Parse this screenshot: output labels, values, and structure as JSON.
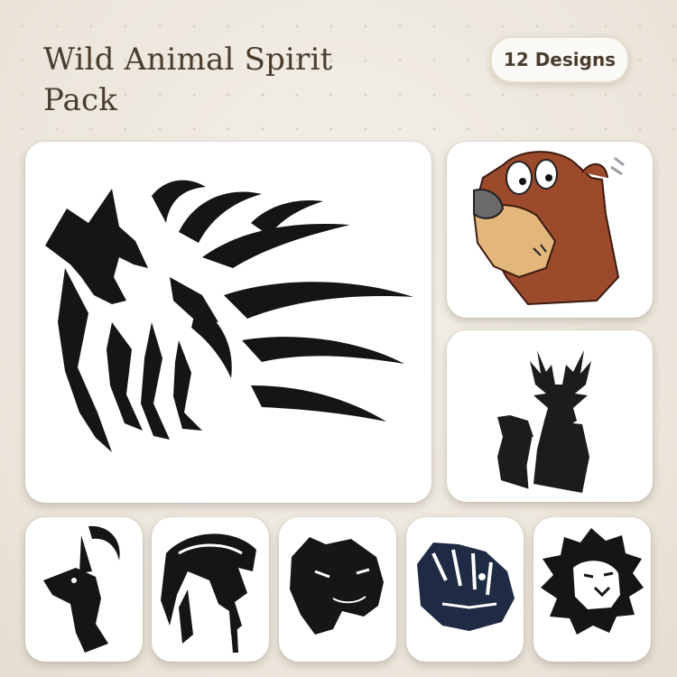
{
  "header": {
    "title": "Wild Animal Spirit Pack",
    "badge": "12 Designs"
  },
  "designs": [
    {
      "name": "tribal wolf and elk",
      "icon": "wolf-elk-icon"
    },
    {
      "name": "brown bear cartoon",
      "icon": "bear-icon"
    },
    {
      "name": "deer silhouette",
      "icon": "deer-icon"
    },
    {
      "name": "ibex",
      "icon": "ibex-icon"
    },
    {
      "name": "sabertooth",
      "icon": "sabertooth-icon"
    },
    {
      "name": "panther",
      "icon": "panther-icon"
    },
    {
      "name": "tiger",
      "icon": "tiger-icon"
    },
    {
      "name": "lion",
      "icon": "lion-icon"
    }
  ],
  "colors": {
    "background": "#ece6dc",
    "title": "#4a3d2e",
    "ink": "#1a1a1a",
    "bear_brown": "#9b4a2b",
    "bear_tan": "#e3b77c"
  }
}
